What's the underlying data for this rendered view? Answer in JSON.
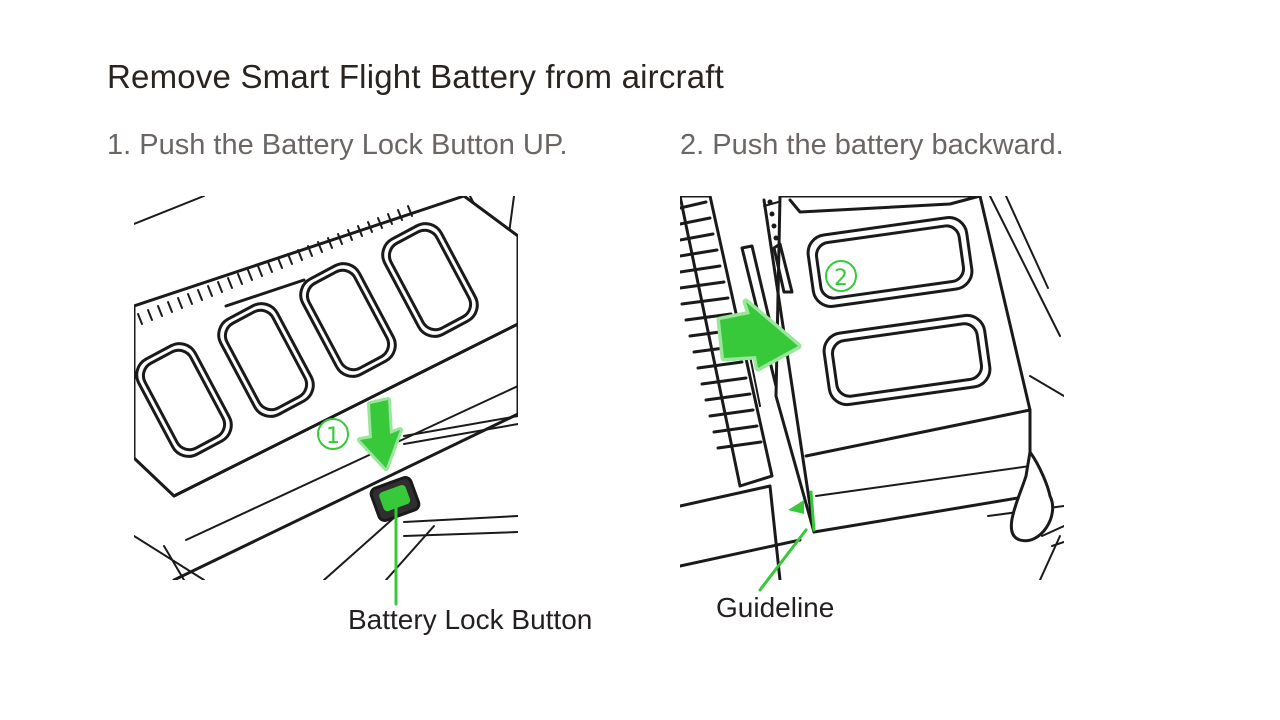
{
  "title": "Remove Smart Flight Battery from aircraft",
  "steps": [
    {
      "label": "1. Push the Battery Lock Button UP.",
      "badge": "①"
    },
    {
      "label": "2. Push the battery backward.",
      "badge": "②"
    }
  ],
  "callouts": {
    "battery_lock_button": "Battery Lock Button",
    "guideline": "Guideline"
  },
  "colors": {
    "accent_green": "#37c93a",
    "text_dark": "#2a2421",
    "text_step": "#6b6664"
  }
}
